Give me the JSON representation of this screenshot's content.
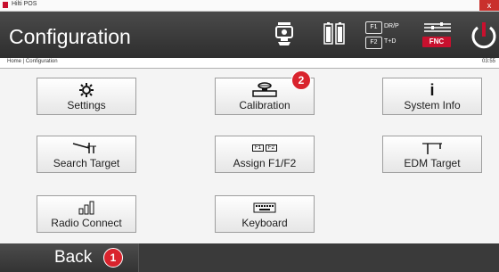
{
  "window": {
    "title": "Hilti POS",
    "close_glyph": "x"
  },
  "header": {
    "title": "Configuration",
    "icons": [
      "instrument-icon",
      "battery-icon",
      "fkeys-icon",
      "fnc-icon",
      "power-icon"
    ],
    "fkeys": {
      "f1_key": "F1",
      "f1_label": "DR/P",
      "f2_key": "F2",
      "f2_label": "T+D"
    },
    "fnc_label": "FNC"
  },
  "breadcrumb": {
    "text": "Home | Configuration",
    "time": "03:55"
  },
  "tiles": [
    {
      "label": "Settings",
      "icon": "gear-icon"
    },
    {
      "label": "Calibration",
      "icon": "calibration-icon"
    },
    {
      "label": "System Info",
      "icon": "info-icon",
      "glyph": "i"
    },
    {
      "label": "Search Target",
      "icon": "search-target-icon"
    },
    {
      "label": "Assign F1/F2",
      "icon": "fkeys-icon",
      "key1": "F1",
      "key2": "F2"
    },
    {
      "label": "EDM Target",
      "icon": "edm-target-icon"
    },
    {
      "label": "Radio Connect",
      "icon": "radio-icon"
    },
    {
      "label": "Keyboard",
      "icon": "keyboard-icon"
    }
  ],
  "callouts": {
    "calibration": "2",
    "back": "1"
  },
  "footer": {
    "back_label": "Back"
  },
  "colors": {
    "accent": "#c8102e",
    "header_bg": "#3a3a3a",
    "callout": "#d9232d"
  }
}
